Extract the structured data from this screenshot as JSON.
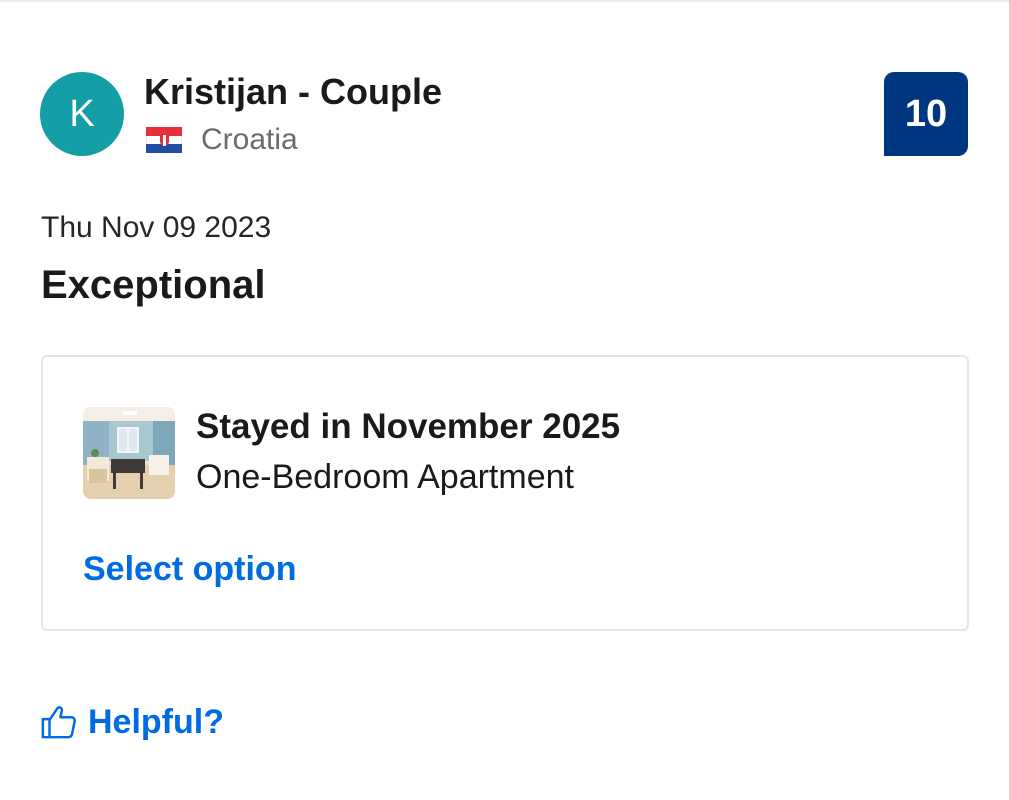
{
  "reviewer": {
    "avatar_initial": "K",
    "name": "Kristijan - Couple",
    "country": "Croatia",
    "country_flag_icon": "croatia-flag-icon"
  },
  "review": {
    "score": "10",
    "date": "Thu Nov 09 2023",
    "title": "Exceptional"
  },
  "stay": {
    "thumbnail_icon": "room-photo-thumbnail",
    "period": "Stayed in November 2025",
    "room_type": "One-Bedroom Apartment",
    "select_option_label": "Select option"
  },
  "helpful": {
    "icon": "thumbs-up-icon",
    "label": "Helpful?"
  },
  "colors": {
    "avatar_bg": "#139ea6",
    "score_bg": "#003580",
    "link": "#006ce4"
  }
}
